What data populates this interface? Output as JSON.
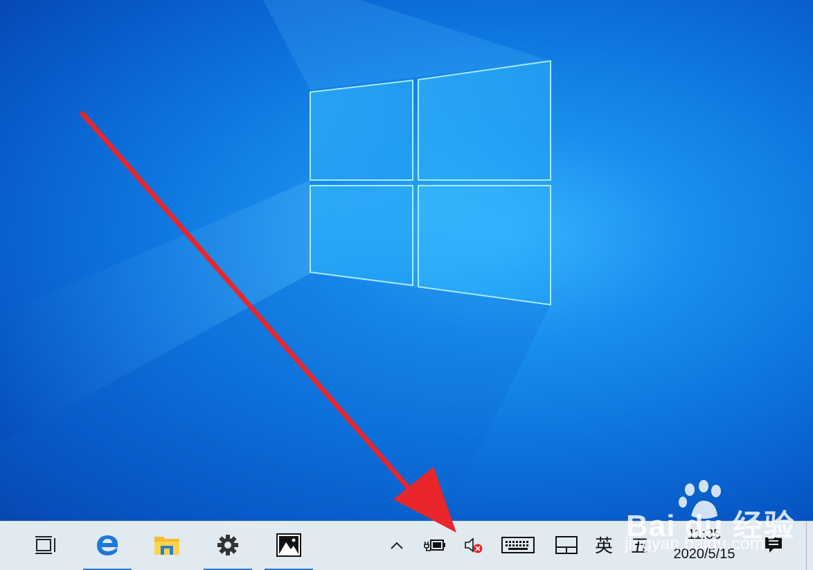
{
  "desktop": {
    "wallpaper": "windows-10-hero",
    "colors": {
      "deep": "#063fa8",
      "mid": "#0d74dd",
      "light": "#39b4ff"
    }
  },
  "annotation": {
    "type": "red-arrow",
    "color": "#e8262b",
    "points_to": "volume-muted-icon"
  },
  "taskbar": {
    "background": "#e1e9f1",
    "running_indicator": "#2a7ac9",
    "pinned": [
      {
        "name": "task-view",
        "icon": "task-view-icon",
        "running": false
      },
      {
        "name": "edge",
        "icon": "edge-icon",
        "running": true
      },
      {
        "name": "file-explorer",
        "icon": "folder-icon",
        "running": false
      },
      {
        "name": "settings",
        "icon": "gear-icon",
        "running": true
      },
      {
        "name": "photos",
        "icon": "photos-icon",
        "running": true
      }
    ],
    "tray": {
      "overflow_icon": "chevron-up-icon",
      "battery_icon": "battery-charging-icon",
      "volume_icon": "volume-muted-icon",
      "keyboard_icon": "touch-keyboard-icon",
      "touchpad_icon": "touchpad-icon",
      "ime_mode": "英",
      "ime_type": "五",
      "action_center_icon": "notification-icon"
    },
    "clock": {
      "time": "11:35",
      "date": "2020/5/15"
    }
  },
  "watermark": {
    "brand": "Bai du 经验",
    "url": "jingyan.baidu.com"
  }
}
